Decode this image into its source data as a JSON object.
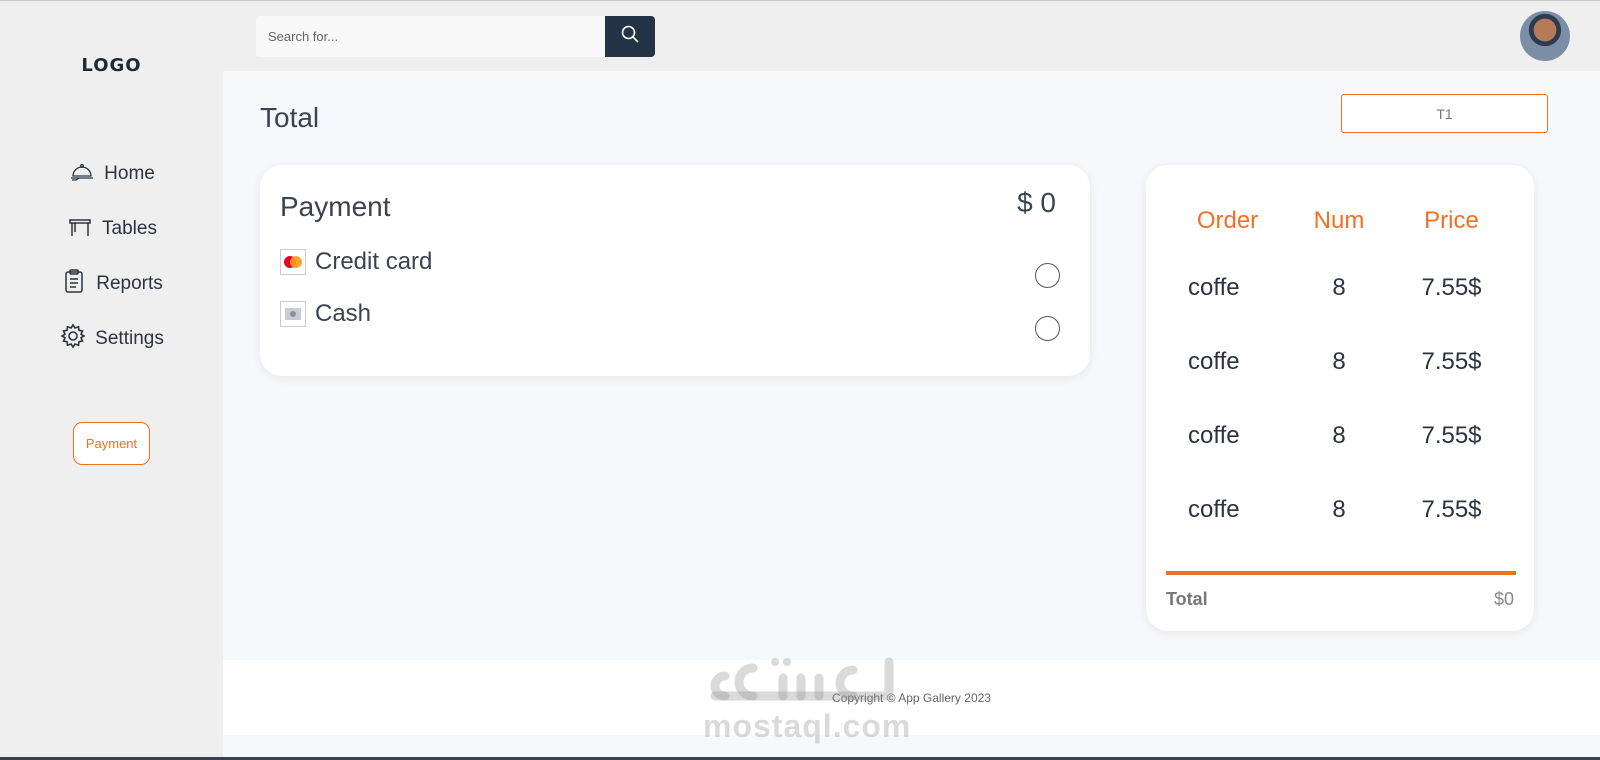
{
  "sidebar": {
    "logo": "LOGO",
    "items": [
      {
        "label": "Home",
        "icon": "cloche-icon"
      },
      {
        "label": "Tables",
        "icon": "table-icon"
      },
      {
        "label": "Reports",
        "icon": "clipboard-icon"
      },
      {
        "label": "Settings",
        "icon": "gear-icon"
      }
    ],
    "payment_button": "Payment"
  },
  "header": {
    "search_placeholder": "Search for...",
    "search_icon": "search-icon",
    "avatar": "user-avatar"
  },
  "main": {
    "title": "Total",
    "table_select": "T1",
    "payment": {
      "title": "Payment",
      "amount": "$ 0",
      "methods": [
        {
          "label": "Credit card",
          "icon": "mastercard-icon"
        },
        {
          "label": "Cash",
          "icon": "cash-icon"
        }
      ]
    },
    "order": {
      "headers": [
        "Order",
        "Num",
        "Price"
      ],
      "rows": [
        [
          "coffe",
          "8",
          "7.55$"
        ],
        [
          "coffe",
          "8",
          "7.55$"
        ],
        [
          "coffe",
          "8",
          "7.55$"
        ],
        [
          "coffe",
          "8",
          "7.55$"
        ]
      ],
      "total_label": "Total",
      "total_value": "$0"
    }
  },
  "footer": {
    "copyright": "Copyright © App Gallery 2023"
  },
  "watermark": {
    "text": "مستقل mostaql.com"
  },
  "colors": {
    "accent": "#f36f21",
    "dark": "#243446",
    "sidebar_bg": "#efefef",
    "page_bg": "#f7f8fb"
  }
}
